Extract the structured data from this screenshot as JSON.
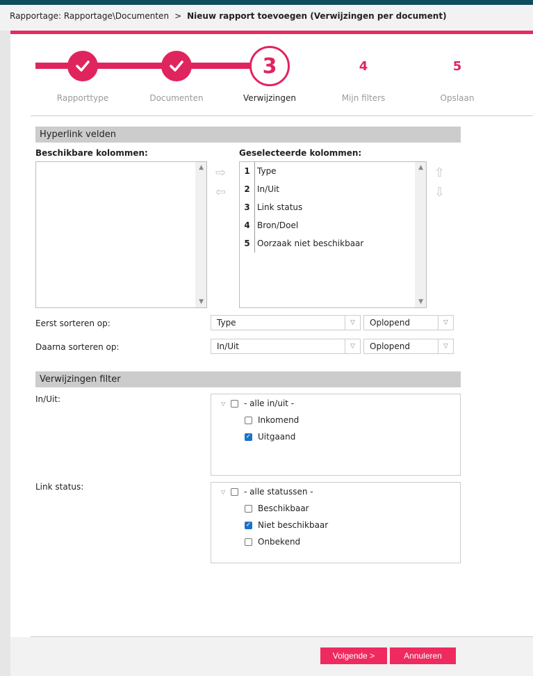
{
  "breadcrumb": {
    "path": "Rapportage: Rapportage\\Documenten",
    "separator": ">",
    "current": "Nieuw rapport toevoegen (Verwijzingen per document)"
  },
  "stepper": {
    "steps": [
      {
        "number": "1",
        "label": "Rapporttype",
        "state": "done"
      },
      {
        "number": "2",
        "label": "Documenten",
        "state": "done"
      },
      {
        "number": "3",
        "label": "Verwijzingen",
        "state": "active"
      },
      {
        "number": "4",
        "label": "Mijn filters",
        "state": "todo"
      },
      {
        "number": "5",
        "label": "Opslaan",
        "state": "todo"
      }
    ],
    "check_glyph": "✓"
  },
  "hyperlink": {
    "section_title": "Hyperlink velden",
    "available_label": "Beschikbare kolommen:",
    "selected_label": "Geselecteerde kolommen:",
    "selected_columns": [
      {
        "num": "1",
        "name": "Type"
      },
      {
        "num": "2",
        "name": "In/Uit"
      },
      {
        "num": "3",
        "name": "Link status"
      },
      {
        "num": "4",
        "name": "Bron/Doel"
      },
      {
        "num": "5",
        "name": "Oorzaak niet beschikbaar"
      }
    ]
  },
  "sorting": {
    "first_label": "Eerst sorteren op:",
    "first_field": "Type",
    "first_order": "Oplopend",
    "then_label": "Daarna sorteren op:",
    "then_field": "In/Uit",
    "then_order": "Oplopend"
  },
  "filter": {
    "section_title": "Verwijzingen filter",
    "inout_label": "In/Uit:",
    "inout_all": "- alle in/uit -",
    "inout_options": [
      {
        "label": "Inkomend",
        "checked": false
      },
      {
        "label": "Uitgaand",
        "checked": true
      }
    ],
    "status_label": "Link status:",
    "status_all": "- alle statussen -",
    "status_options": [
      {
        "label": "Beschikbaar",
        "checked": false
      },
      {
        "label": "Niet beschikbaar",
        "checked": true
      },
      {
        "label": "Onbekend",
        "checked": false
      }
    ]
  },
  "footer": {
    "next_label": "Volgende >",
    "cancel_label": "Annuleren"
  },
  "colors": {
    "accent": "#e0245e",
    "top_strip": "#0f4c5c",
    "section_header": "#cccccc",
    "checkbox_checked": "#1a73c8"
  },
  "icons": {
    "move_right": "arrow-right-icon",
    "move_left": "arrow-left-icon",
    "move_up": "arrow-up-icon",
    "move_down": "arrow-down-icon",
    "expand": "triangle-down-icon"
  }
}
